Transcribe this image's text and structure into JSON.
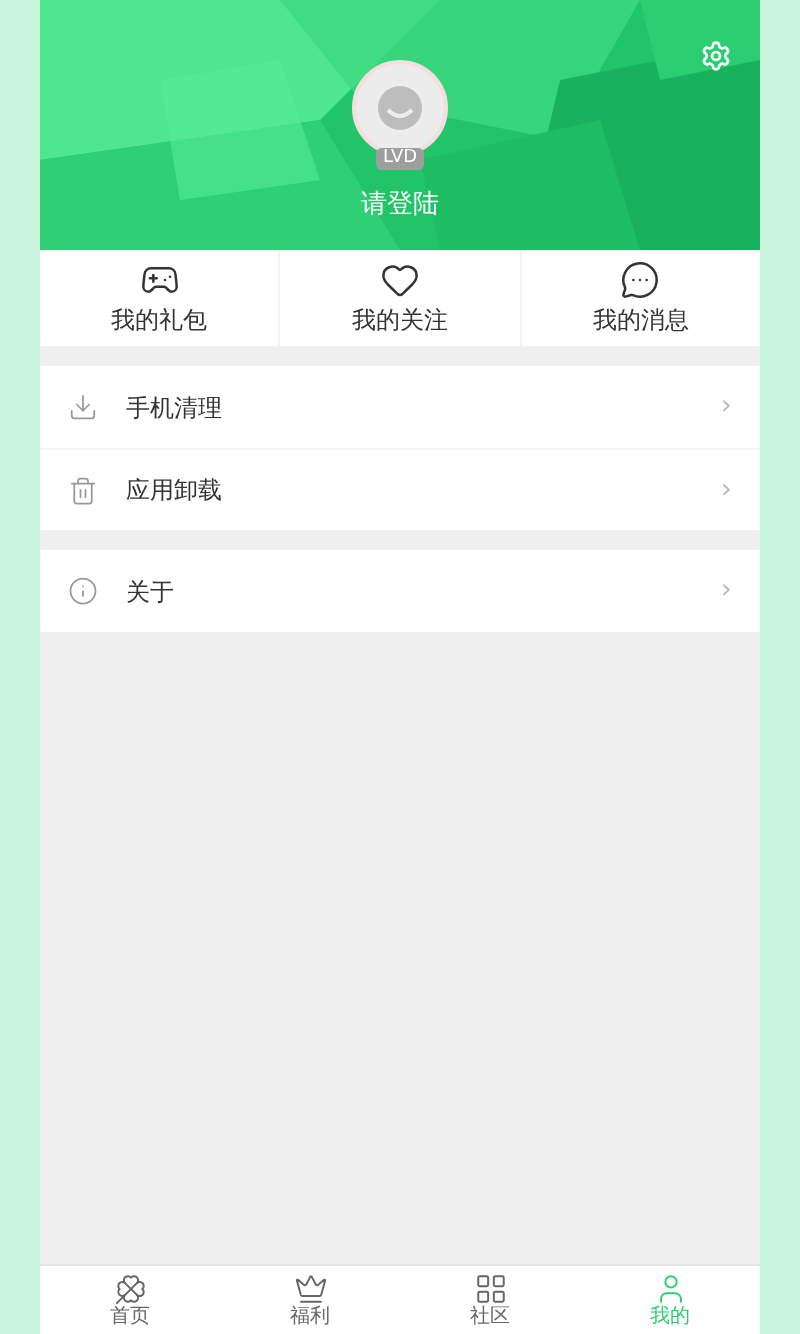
{
  "header": {
    "level_badge": "LVD",
    "login_label": "请登陆"
  },
  "shortcuts": [
    {
      "label": "我的礼包"
    },
    {
      "label": "我的关注"
    },
    {
      "label": "我的消息"
    }
  ],
  "menu_groups": [
    {
      "items": [
        {
          "label": "手机清理",
          "chevron": "›"
        },
        {
          "label": "应用卸载",
          "chevron": "›"
        }
      ]
    },
    {
      "items": [
        {
          "label": "关于",
          "chevron": "›"
        }
      ]
    }
  ],
  "tab_bar": [
    {
      "label": "首页",
      "selected": false
    },
    {
      "label": "福利",
      "selected": false
    },
    {
      "label": "社区",
      "selected": false
    },
    {
      "label": "我的",
      "selected": true
    }
  ]
}
